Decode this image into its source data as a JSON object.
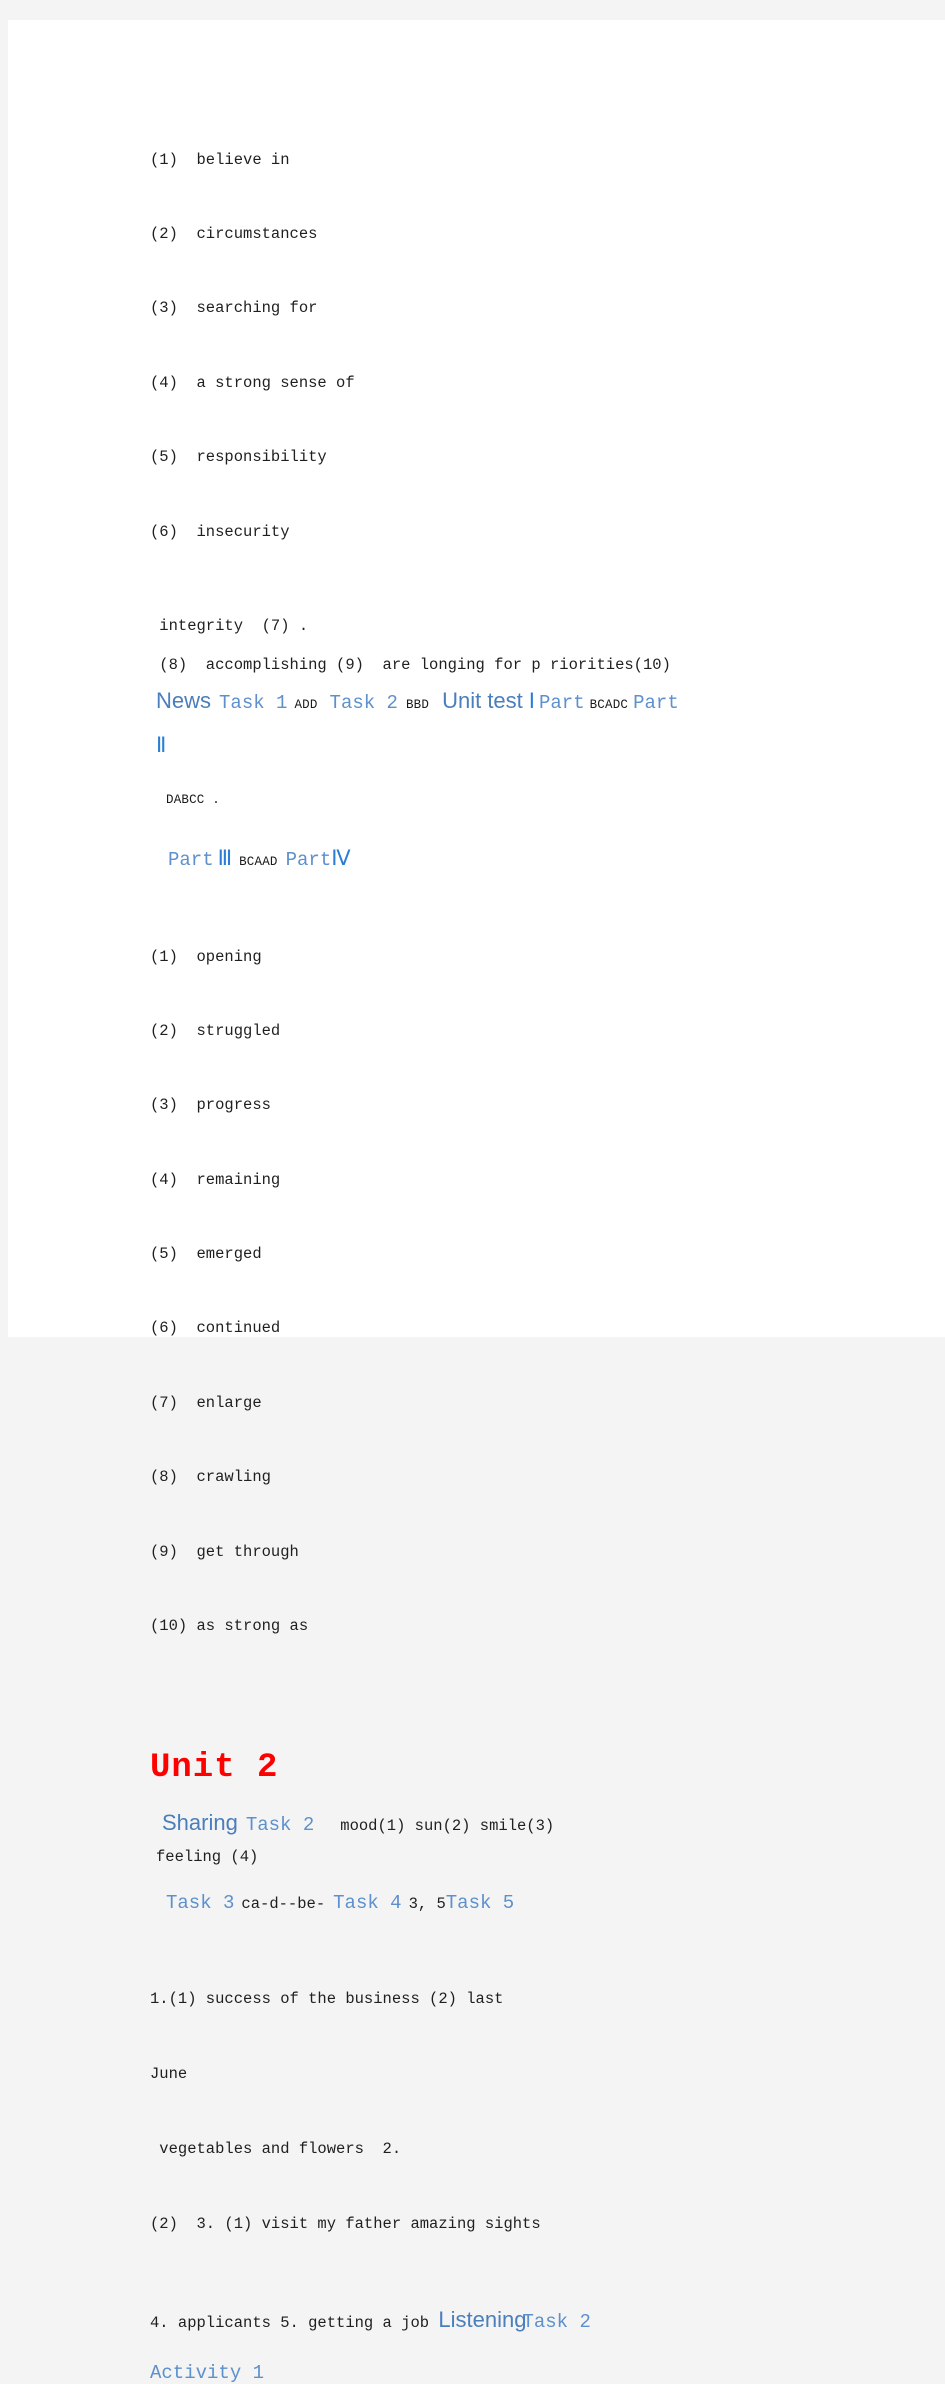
{
  "document": {
    "page_background": "#ffffff",
    "canvas_background": "#f4f4f4",
    "accent_blue": "#4a7ebc",
    "accent_blue_mono": "#5d90cc",
    "roman_blue": "#2a7fd4",
    "heading_red": "#ff0000"
  },
  "unit1": {
    "answers_a": [
      "(1)  believe in",
      "(2)  circumstances",
      "(3)  searching for",
      "(4)  a strong sense of",
      "(5)  responsibility",
      "(6)  insecurity"
    ],
    "integrity_line": " integrity  (7) .",
    "accomplishing_line": " (8)  accomplishing (9)  are longing for p riorities(10)",
    "news_row": {
      "news_label": "News",
      "task1_label": "Task 1",
      "task1_answer": "ADD",
      "task2_label": "Task 2",
      "task2_answer": "BBD",
      "unit_test_label": "Unit test",
      "roman_1": "Ⅰ",
      "part_label_1": "Part",
      "part1_answer": "BCADC",
      "part_label_2": "Part"
    },
    "roman_2": "Ⅱ",
    "dabcc_line": "DABCC .",
    "part_row_2": {
      "part_label_3": "Part",
      "roman_3": "Ⅲ",
      "part3_answer": "BCAAD",
      "part_label_4": "Part",
      "roman_4": "Ⅳ"
    },
    "answers_b": [
      "(1)  opening",
      "(2)  struggled",
      "(3)  progress",
      "(4)  remaining",
      "(5)  emerged",
      "(6)  continued",
      "(7)  enlarge",
      "(8)  crawling",
      "(9)  get through",
      "(10) as strong as"
    ]
  },
  "unit2": {
    "title": "Unit 2",
    "sharing_row": {
      "sharing_label": "Sharing",
      "task2_label": "Task 2",
      "answers": "mood(1)   sun(2)  smile(3)"
    },
    "feeling_line": "feeling (4)",
    "task_row": {
      "task3_label": "Task 3",
      "task3_answer": "ca-d--be-",
      "task4_label": "Task 4",
      "task4_answer": "3, 5",
      "task5_label": "Task 5"
    },
    "body_lines": [
      "1.(1) success of the business (2) last",
      "June",
      " vegetables and flowers  2.",
      "(2)  3. (1) visit my father amazing sights"
    ],
    "listening_row": {
      "prefix": " 4.  applicants 5.  getting a job ",
      "listening_label": "Listening",
      "task2_label": "Task 2"
    },
    "activity_line": "Activity 1"
  }
}
